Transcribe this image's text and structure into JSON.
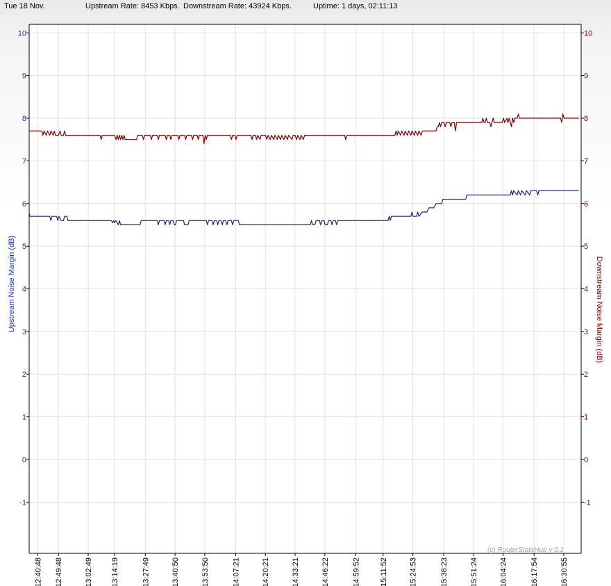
{
  "header": {
    "date": "Tue 18 Nov.",
    "upstream_rate": "Upstream Rate: 8453 Kbps.",
    "downstream_rate": "Downstream Rate: 43924 Kbps.",
    "uptime": "Uptime: 1 days, 02:11:13"
  },
  "copyright": "(c) RouterStatsHub v 0.1",
  "colors": {
    "upstream": "#1a237e",
    "downstream": "#7a0000",
    "grid": "#e2e2e2",
    "upstream_axis": "#1c2fb0",
    "downstream_axis": "#7a0000"
  },
  "chart_data": {
    "type": "line",
    "title": "",
    "xlabel": "",
    "ylabel": "Upstream Noise Margin (dB)",
    "y2label": "Downstream Noise Margin (dB)",
    "ylim": [
      -2.2,
      10.2
    ],
    "yticks": [
      -1,
      0,
      1,
      2,
      3,
      4,
      5,
      6,
      7,
      8,
      9,
      10
    ],
    "y2ticks": [
      -1,
      0,
      1,
      2,
      3,
      4,
      5,
      6,
      7,
      8,
      9,
      10
    ],
    "grid": true,
    "xlim": [
      "12:37:00",
      "16:38:30"
    ],
    "xticks": [
      "12:40:48",
      "12:49:48",
      "13:02:49",
      "13:14:19",
      "13:27:49",
      "13:40:50",
      "13:53:50",
      "14:07:21",
      "14:20:21",
      "14:33:21",
      "14:46:22",
      "14:59:52",
      "15:11:52",
      "15:24:53",
      "15:38:23",
      "15:51:24",
      "16:04:24",
      "16:17:54",
      "16:30:55"
    ],
    "series": [
      {
        "name": "Downstream Noise Margin (dB)",
        "axis": "right",
        "points": [
          [
            "12:37:00",
            7.7
          ],
          [
            "12:42:30",
            7.7
          ],
          [
            "12:43:00",
            7.6
          ],
          [
            "12:43:30",
            7.7
          ],
          [
            "12:44:30",
            7.6
          ],
          [
            "12:45:00",
            7.7
          ],
          [
            "12:46:00",
            7.6
          ],
          [
            "12:46:30",
            7.7
          ],
          [
            "12:47:30",
            7.6
          ],
          [
            "12:48:00",
            7.7
          ],
          [
            "12:48:30",
            7.6
          ],
          [
            "12:49:48",
            7.6
          ],
          [
            "12:50:30",
            7.7
          ],
          [
            "12:51:00",
            7.6
          ],
          [
            "12:52:00",
            7.6
          ],
          [
            "12:52:30",
            7.7
          ],
          [
            "12:53:00",
            7.6
          ],
          [
            "13:08:00",
            7.6
          ],
          [
            "13:08:30",
            7.5
          ],
          [
            "13:09:00",
            7.6
          ],
          [
            "13:14:19",
            7.6
          ],
          [
            "13:15:00",
            7.5
          ],
          [
            "13:15:30",
            7.6
          ],
          [
            "13:16:00",
            7.5
          ],
          [
            "13:16:30",
            7.6
          ],
          [
            "13:17:00",
            7.5
          ],
          [
            "13:17:30",
            7.6
          ],
          [
            "13:18:00",
            7.5
          ],
          [
            "13:18:30",
            7.6
          ],
          [
            "13:19:00",
            7.5
          ],
          [
            "13:24:00",
            7.5
          ],
          [
            "13:24:30",
            7.6
          ],
          [
            "13:26:30",
            7.6
          ],
          [
            "13:27:00",
            7.5
          ],
          [
            "13:27:30",
            7.6
          ],
          [
            "13:30:00",
            7.6
          ],
          [
            "13:30:30",
            7.5
          ],
          [
            "13:31:00",
            7.6
          ],
          [
            "13:33:00",
            7.6
          ],
          [
            "13:33:30",
            7.5
          ],
          [
            "13:34:00",
            7.6
          ],
          [
            "13:36:30",
            7.6
          ],
          [
            "13:37:00",
            7.5
          ],
          [
            "13:37:30",
            7.6
          ],
          [
            "13:38:30",
            7.6
          ],
          [
            "13:39:00",
            7.5
          ],
          [
            "13:39:30",
            7.6
          ],
          [
            "13:42:00",
            7.6
          ],
          [
            "13:42:30",
            7.5
          ],
          [
            "13:43:00",
            7.6
          ],
          [
            "13:45:00",
            7.6
          ],
          [
            "13:45:30",
            7.5
          ],
          [
            "13:46:00",
            7.6
          ],
          [
            "13:48:00",
            7.6
          ],
          [
            "13:48:30",
            7.5
          ],
          [
            "13:49:00",
            7.6
          ],
          [
            "13:50:30",
            7.6
          ],
          [
            "13:51:00",
            7.5
          ],
          [
            "13:51:30",
            7.6
          ],
          [
            "13:53:00",
            7.6
          ],
          [
            "13:53:30",
            7.4
          ],
          [
            "13:54:00",
            7.6
          ],
          [
            "13:54:30",
            7.5
          ],
          [
            "13:55:00",
            7.6
          ],
          [
            "14:05:00",
            7.6
          ],
          [
            "14:05:30",
            7.5
          ],
          [
            "14:06:00",
            7.6
          ],
          [
            "14:07:00",
            7.6
          ],
          [
            "14:07:30",
            7.5
          ],
          [
            "14:08:00",
            7.6
          ],
          [
            "14:14:00",
            7.6
          ],
          [
            "14:14:30",
            7.5
          ],
          [
            "14:15:00",
            7.6
          ],
          [
            "14:16:00",
            7.6
          ],
          [
            "14:16:30",
            7.5
          ],
          [
            "14:17:00",
            7.6
          ],
          [
            "14:18:00",
            7.5
          ],
          [
            "14:18:30",
            7.6
          ],
          [
            "14:20:21",
            7.6
          ],
          [
            "14:21:00",
            7.5
          ],
          [
            "14:21:30",
            7.6
          ],
          [
            "14:22:30",
            7.5
          ],
          [
            "14:23:00",
            7.6
          ],
          [
            "14:24:00",
            7.5
          ],
          [
            "14:24:30",
            7.6
          ],
          [
            "14:25:30",
            7.5
          ],
          [
            "14:26:00",
            7.6
          ],
          [
            "14:27:00",
            7.5
          ],
          [
            "14:27:30",
            7.6
          ],
          [
            "14:28:30",
            7.5
          ],
          [
            "14:29:00",
            7.6
          ],
          [
            "14:30:00",
            7.5
          ],
          [
            "14:30:30",
            7.6
          ],
          [
            "14:32:00",
            7.5
          ],
          [
            "14:32:30",
            7.6
          ],
          [
            "14:33:21",
            7.6
          ],
          [
            "14:34:00",
            7.5
          ],
          [
            "14:34:30",
            7.6
          ],
          [
            "14:35:30",
            7.5
          ],
          [
            "14:36:00",
            7.6
          ],
          [
            "14:37:00",
            7.5
          ],
          [
            "14:37:30",
            7.6
          ],
          [
            "14:55:00",
            7.6
          ],
          [
            "14:55:30",
            7.5
          ],
          [
            "14:56:00",
            7.6
          ],
          [
            "15:17:00",
            7.6
          ],
          [
            "15:17:30",
            7.7
          ],
          [
            "15:18:00",
            7.6
          ],
          [
            "15:18:30",
            7.7
          ],
          [
            "15:19:30",
            7.6
          ],
          [
            "15:20:00",
            7.7
          ],
          [
            "15:21:00",
            7.6
          ],
          [
            "15:21:30",
            7.7
          ],
          [
            "15:22:30",
            7.6
          ],
          [
            "15:23:00",
            7.7
          ],
          [
            "15:24:00",
            7.6
          ],
          [
            "15:24:30",
            7.7
          ],
          [
            "15:25:30",
            7.6
          ],
          [
            "15:26:00",
            7.7
          ],
          [
            "15:27:00",
            7.6
          ],
          [
            "15:27:30",
            7.7
          ],
          [
            "15:28:30",
            7.6
          ],
          [
            "15:29:00",
            7.7
          ],
          [
            "15:30:00",
            7.7
          ],
          [
            "15:35:00",
            7.7
          ],
          [
            "15:35:30",
            7.8
          ],
          [
            "15:36:00",
            7.8
          ],
          [
            "15:36:30",
            7.9
          ],
          [
            "15:37:00",
            7.8
          ],
          [
            "15:37:30",
            7.9
          ],
          [
            "15:38:30",
            7.9
          ],
          [
            "15:39:00",
            7.8
          ],
          [
            "15:39:30",
            7.9
          ],
          [
            "15:41:00",
            7.9
          ],
          [
            "15:41:30",
            7.8
          ],
          [
            "15:42:00",
            7.9
          ],
          [
            "15:43:00",
            7.9
          ],
          [
            "15:43:30",
            7.7
          ],
          [
            "15:44:00",
            7.9
          ],
          [
            "15:55:00",
            7.9
          ],
          [
            "15:55:30",
            8.0
          ],
          [
            "15:56:00",
            7.9
          ],
          [
            "15:56:30",
            7.9
          ],
          [
            "15:57:00",
            8.0
          ],
          [
            "15:57:30",
            7.9
          ],
          [
            "15:58:30",
            7.9
          ],
          [
            "15:59:00",
            7.8
          ],
          [
            "15:59:30",
            7.9
          ],
          [
            "16:00:00",
            8.0
          ],
          [
            "16:00:30",
            7.9
          ],
          [
            "16:04:00",
            7.9
          ],
          [
            "16:04:30",
            8.0
          ],
          [
            "16:05:00",
            7.9
          ],
          [
            "16:06:00",
            8.0
          ],
          [
            "16:06:30",
            7.9
          ],
          [
            "16:07:00",
            8.0
          ],
          [
            "16:07:30",
            7.9
          ],
          [
            "16:08:00",
            7.8
          ],
          [
            "16:08:30",
            8.0
          ],
          [
            "16:09:00",
            7.9
          ],
          [
            "16:09:30",
            8.0
          ],
          [
            "16:10:30",
            8.0
          ],
          [
            "16:11:00",
            8.1
          ],
          [
            "16:11:30",
            8.0
          ],
          [
            "16:29:30",
            8.0
          ],
          [
            "16:30:00",
            7.9
          ],
          [
            "16:30:30",
            8.1
          ],
          [
            "16:31:00",
            8.0
          ],
          [
            "16:37:30",
            8.0
          ]
        ]
      },
      {
        "name": "Upstream Noise Margin (dB)",
        "axis": "left",
        "points": [
          [
            "12:37:00",
            5.8
          ],
          [
            "12:37:20",
            5.7
          ],
          [
            "12:46:00",
            5.7
          ],
          [
            "12:46:30",
            5.6
          ],
          [
            "12:47:00",
            5.7
          ],
          [
            "12:49:00",
            5.7
          ],
          [
            "12:49:30",
            5.6
          ],
          [
            "12:50:00",
            5.7
          ],
          [
            "12:51:00",
            5.6
          ],
          [
            "12:52:00",
            5.6
          ],
          [
            "12:52:30",
            5.7
          ],
          [
            "12:53:30",
            5.7
          ],
          [
            "12:54:00",
            5.6
          ],
          [
            "13:13:00",
            5.6
          ],
          [
            "13:13:30",
            5.55
          ],
          [
            "13:14:00",
            5.6
          ],
          [
            "13:14:19",
            5.55
          ],
          [
            "13:15:00",
            5.6
          ],
          [
            "13:16:00",
            5.5
          ],
          [
            "13:16:30",
            5.6
          ],
          [
            "13:17:00",
            5.5
          ],
          [
            "13:20:00",
            5.5
          ],
          [
            "13:25:30",
            5.5
          ],
          [
            "13:26:00",
            5.6
          ],
          [
            "13:33:00",
            5.6
          ],
          [
            "13:33:30",
            5.5
          ],
          [
            "13:34:00",
            5.6
          ],
          [
            "13:36:00",
            5.6
          ],
          [
            "13:36:30",
            5.5
          ],
          [
            "13:37:00",
            5.6
          ],
          [
            "13:38:00",
            5.6
          ],
          [
            "13:38:30",
            5.5
          ],
          [
            "13:39:00",
            5.6
          ],
          [
            "13:40:00",
            5.6
          ],
          [
            "13:40:30",
            5.5
          ],
          [
            "13:41:00",
            5.5
          ],
          [
            "13:41:30",
            5.6
          ],
          [
            "13:44:30",
            5.6
          ],
          [
            "13:45:00",
            5.5
          ],
          [
            "13:46:30",
            5.5
          ],
          [
            "13:47:00",
            5.6
          ],
          [
            "13:54:30",
            5.6
          ],
          [
            "13:55:00",
            5.5
          ],
          [
            "13:55:30",
            5.6
          ],
          [
            "13:57:00",
            5.6
          ],
          [
            "13:57:30",
            5.5
          ],
          [
            "13:58:00",
            5.6
          ],
          [
            "13:59:00",
            5.6
          ],
          [
            "13:59:30",
            5.5
          ],
          [
            "14:00:00",
            5.6
          ],
          [
            "14:01:00",
            5.6
          ],
          [
            "14:01:30",
            5.5
          ],
          [
            "14:02:00",
            5.6
          ],
          [
            "14:03:00",
            5.6
          ],
          [
            "14:03:30",
            5.5
          ],
          [
            "14:04:00",
            5.6
          ],
          [
            "14:05:30",
            5.6
          ],
          [
            "14:06:00",
            5.5
          ],
          [
            "14:06:30",
            5.6
          ],
          [
            "14:08:30",
            5.6
          ],
          [
            "14:09:00",
            5.5
          ],
          [
            "14:40:00",
            5.5
          ],
          [
            "14:40:30",
            5.6
          ],
          [
            "14:41:00",
            5.5
          ],
          [
            "14:42:00",
            5.5
          ],
          [
            "14:42:30",
            5.6
          ],
          [
            "14:44:00",
            5.6
          ],
          [
            "14:44:30",
            5.5
          ],
          [
            "14:45:00",
            5.6
          ],
          [
            "14:46:00",
            5.6
          ],
          [
            "14:46:30",
            5.5
          ],
          [
            "14:47:30",
            5.5
          ],
          [
            "14:48:00",
            5.6
          ],
          [
            "14:49:00",
            5.6
          ],
          [
            "14:49:30",
            5.5
          ],
          [
            "14:50:00",
            5.6
          ],
          [
            "14:51:00",
            5.6
          ],
          [
            "14:51:30",
            5.5
          ],
          [
            "14:52:00",
            5.6
          ],
          [
            "15:14:00",
            5.6
          ],
          [
            "15:14:30",
            5.7
          ],
          [
            "15:15:00",
            5.6
          ],
          [
            "15:15:30",
            5.7
          ],
          [
            "15:24:00",
            5.7
          ],
          [
            "15:24:30",
            5.8
          ],
          [
            "15:25:00",
            5.7
          ],
          [
            "15:26:30",
            5.7
          ],
          [
            "15:27:00",
            5.8
          ],
          [
            "15:27:30",
            5.7
          ],
          [
            "15:29:00",
            5.8
          ],
          [
            "15:31:00",
            5.8
          ],
          [
            "15:32:00",
            5.9
          ],
          [
            "15:34:00",
            5.9
          ],
          [
            "15:35:00",
            6.0
          ],
          [
            "15:37:30",
            6.0
          ],
          [
            "15:38:00",
            6.1
          ],
          [
            "15:48:00",
            6.1
          ],
          [
            "15:48:30",
            6.2
          ],
          [
            "16:07:30",
            6.2
          ],
          [
            "16:08:00",
            6.3
          ],
          [
            "16:08:30",
            6.2
          ],
          [
            "16:09:00",
            6.3
          ],
          [
            "16:10:30",
            6.2
          ],
          [
            "16:11:00",
            6.3
          ],
          [
            "16:12:00",
            6.2
          ],
          [
            "16:12:30",
            6.3
          ],
          [
            "16:14:00",
            6.2
          ],
          [
            "16:14:30",
            6.3
          ],
          [
            "16:16:00",
            6.2
          ],
          [
            "16:16:30",
            6.3
          ],
          [
            "16:19:00",
            6.3
          ],
          [
            "16:19:30",
            6.2
          ],
          [
            "16:20:00",
            6.3
          ],
          [
            "16:37:30",
            6.3
          ]
        ]
      }
    ]
  }
}
